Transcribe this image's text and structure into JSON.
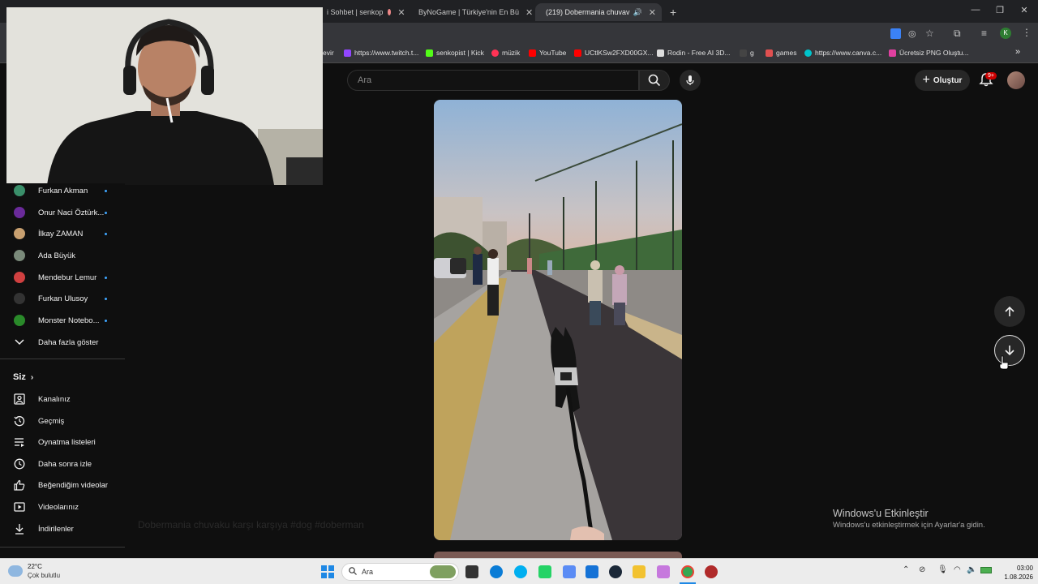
{
  "browser": {
    "tabs": [
      {
        "label": "i Sohbet | senkop",
        "active": false
      },
      {
        "label": "ByNoGame | Türkiye'nin En Bü",
        "active": false
      },
      {
        "label": "(219) Dobermania chuvav",
        "active": true
      }
    ],
    "new_tab": "+",
    "bookmarks": [
      {
        "label": "evir",
        "color": "#555"
      },
      {
        "label": "https://www.twitch.t...",
        "color": "#9146ff"
      },
      {
        "label": "senkopist | Kick",
        "color": "#53fc18"
      },
      {
        "label": "müzik",
        "color": "#ff3355"
      },
      {
        "label": "YouTube",
        "color": "#ff0000"
      },
      {
        "label": "UCtlKSw2FXD00GX...",
        "color": "#ff0000"
      },
      {
        "label": "Rodin - Free AI 3D...",
        "color": "#dddddd"
      },
      {
        "label": "g",
        "color": "#333"
      },
      {
        "label": "games",
        "color": "#e05050"
      },
      {
        "label": "https://www.canva.c...",
        "color": "#00c4cc"
      },
      {
        "label": "Ücretsiz PNG Oluştu...",
        "color": "#e040a0"
      }
    ]
  },
  "header": {
    "search_placeholder": "Ara",
    "create_label": "Oluştur",
    "notification_badge": "9+"
  },
  "sidebar": {
    "subscriptions": [
      {
        "label": "Furkan Akman",
        "color": "#3a8f6a",
        "dot": true
      },
      {
        "label": "Onur Naci Öztürk...",
        "color": "#6a2a9a",
        "dot": true
      },
      {
        "label": "İlkay ZAMAN",
        "color": "#c8a070",
        "dot": true
      },
      {
        "label": "Ada Büyük",
        "color": "#7a8a7a",
        "dot": false
      },
      {
        "label": "Mendebur Lemur",
        "color": "#d04040",
        "dot": true
      },
      {
        "label": "Furkan Ulusoy",
        "color": "#222222",
        "dot": true
      },
      {
        "label": "Monster Notebo...",
        "color": "#2a8a2a",
        "dot": true
      }
    ],
    "show_more": "Daha fazla göster",
    "you_section": "Siz",
    "you_items": [
      {
        "label": "Kanalınız",
        "icon": "channel-icon"
      },
      {
        "label": "Geçmiş",
        "icon": "history-icon"
      },
      {
        "label": "Oynatma listeleri",
        "icon": "playlists-icon"
      },
      {
        "label": "Daha sonra izle",
        "icon": "watch-later-icon"
      },
      {
        "label": "Beğendiğim videolar",
        "icon": "like-icon"
      },
      {
        "label": "Videolarınız",
        "icon": "your-videos-icon"
      },
      {
        "label": "İndirilenler",
        "icon": "download-icon"
      }
    ]
  },
  "windows_activation": {
    "title": "Windows'u Etkinleştir",
    "subtitle": "Windows'u etkinleştirmek için Ayarlar'a gidin."
  },
  "faded_title": "Dobermania chuvaku karşı karşıya #dog #doberman",
  "taskbar": {
    "weather_temp": "22°C",
    "weather_desc": "Çok bulutlu",
    "search_label": "Ara",
    "time": "03:00",
    "date": "1.08.2026"
  }
}
